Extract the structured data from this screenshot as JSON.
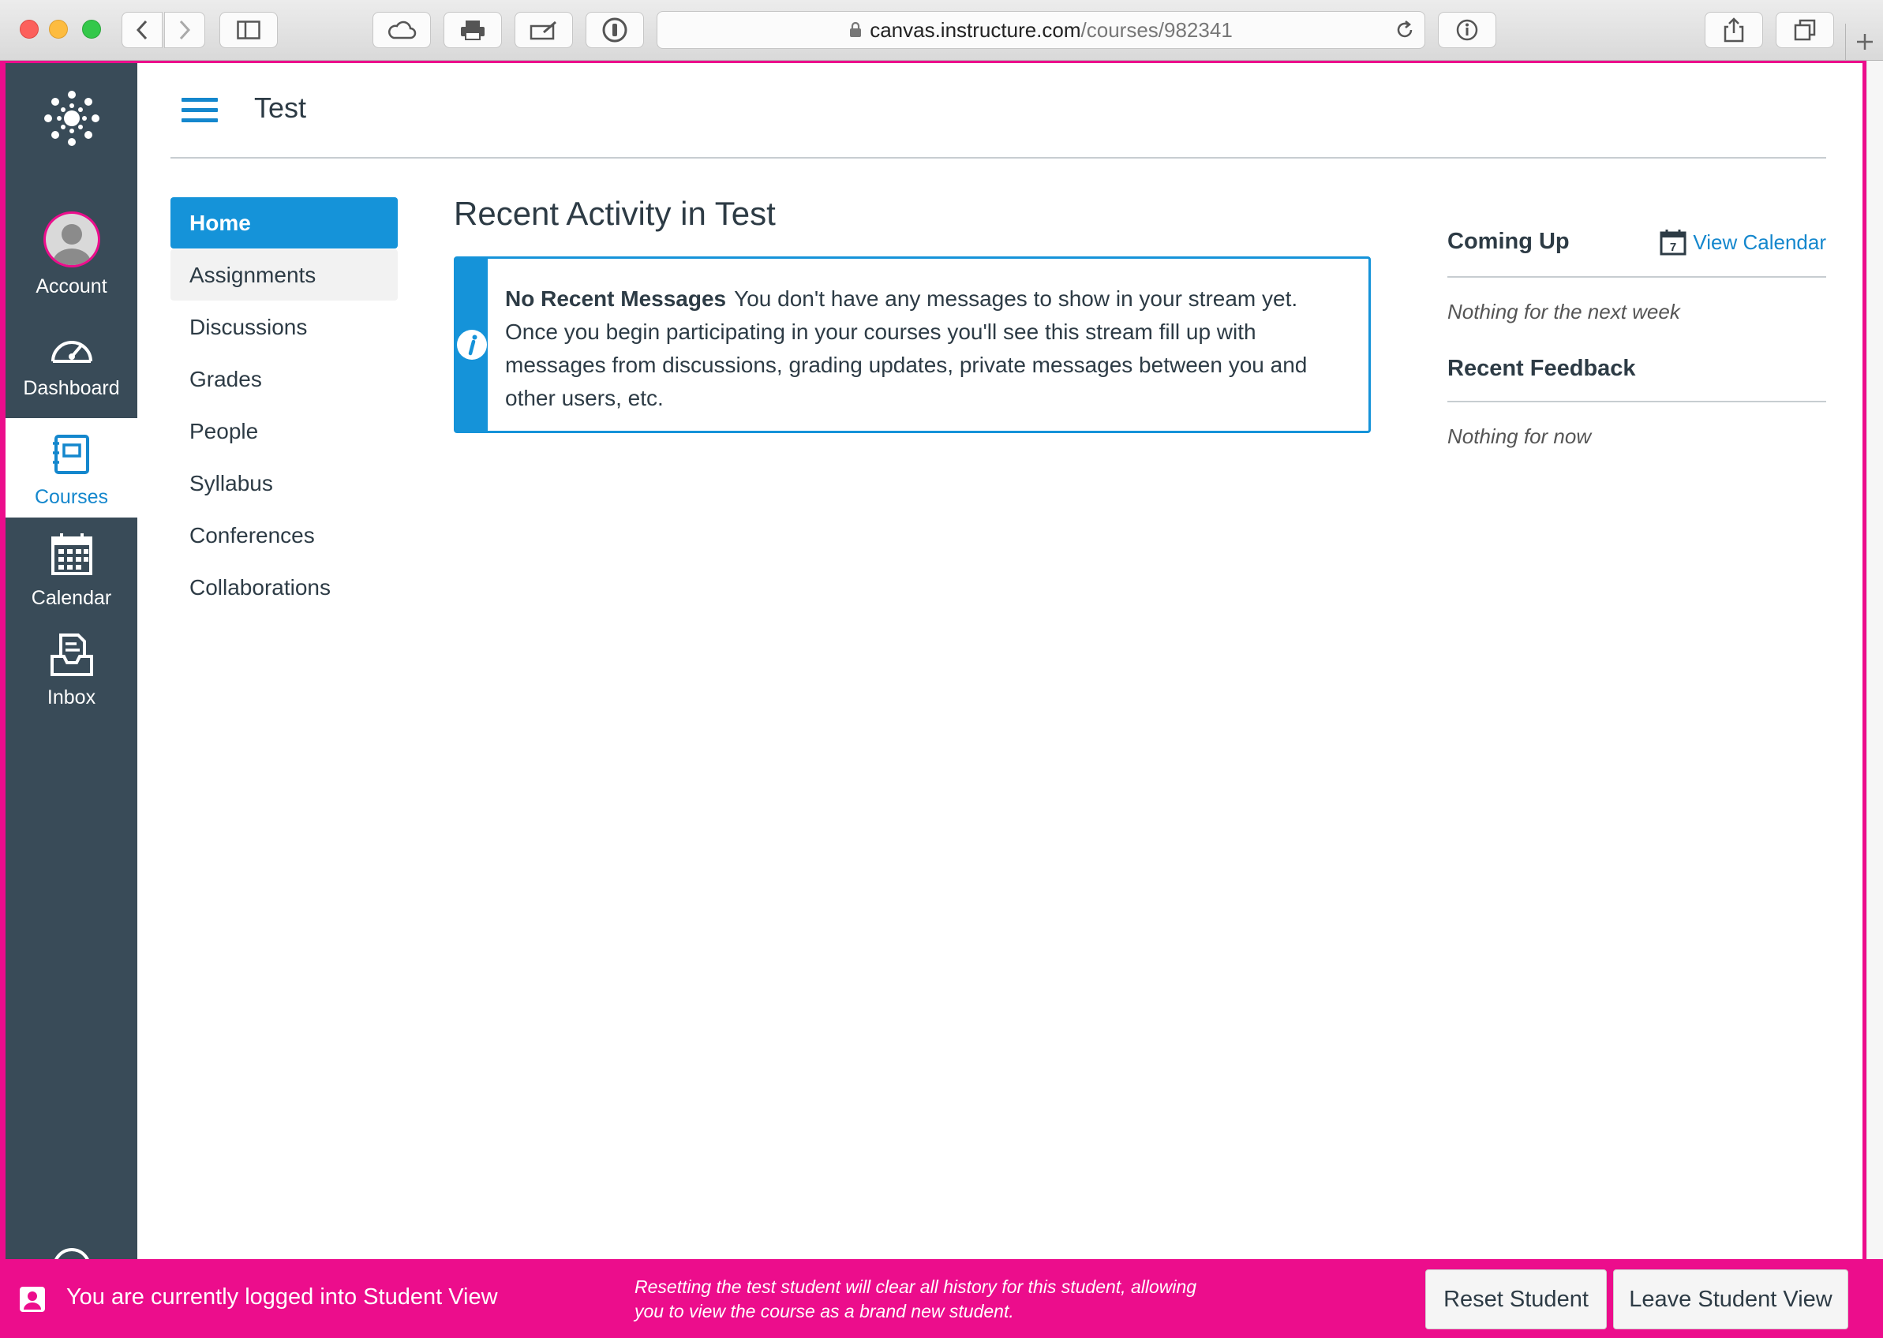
{
  "browser": {
    "url_host": "canvas.instructure.com",
    "url_path": "/courses/982341"
  },
  "global_nav": {
    "items": [
      {
        "label": "Account"
      },
      {
        "label": "Dashboard"
      },
      {
        "label": "Courses"
      },
      {
        "label": "Calendar"
      },
      {
        "label": "Inbox"
      }
    ]
  },
  "header": {
    "course_title": "Test"
  },
  "course_nav": {
    "items": [
      {
        "label": "Home"
      },
      {
        "label": "Assignments"
      },
      {
        "label": "Discussions"
      },
      {
        "label": "Grades"
      },
      {
        "label": "People"
      },
      {
        "label": "Syllabus"
      },
      {
        "label": "Conferences"
      },
      {
        "label": "Collaborations"
      }
    ]
  },
  "main": {
    "heading": "Recent Activity in Test",
    "alert_title": "No Recent Messages",
    "alert_text": "You don't have any messages to show in your stream yet. Once you begin participating in your courses you'll see this stream fill up with messages from discussions, grading updates, private messages between you and other users, etc."
  },
  "sidebar": {
    "coming_up": "Coming Up",
    "view_calendar": "View Calendar",
    "calendar_day": "7",
    "coming_up_empty": "Nothing for the next week",
    "recent_feedback": "Recent Feedback",
    "feedback_empty": "Nothing for now"
  },
  "footer": {
    "status": "You are currently logged into Student View",
    "note_line1": "Resetting the test student will clear all history for this student, allowing",
    "note_line2": "you to view the course as a brand new student.",
    "reset_label": "Reset Student",
    "leave_label": "Leave Student View"
  },
  "colors": {
    "brand_pink": "#ec0d8c",
    "nav_dark": "#394b58",
    "accent_blue": "#1593d9"
  }
}
